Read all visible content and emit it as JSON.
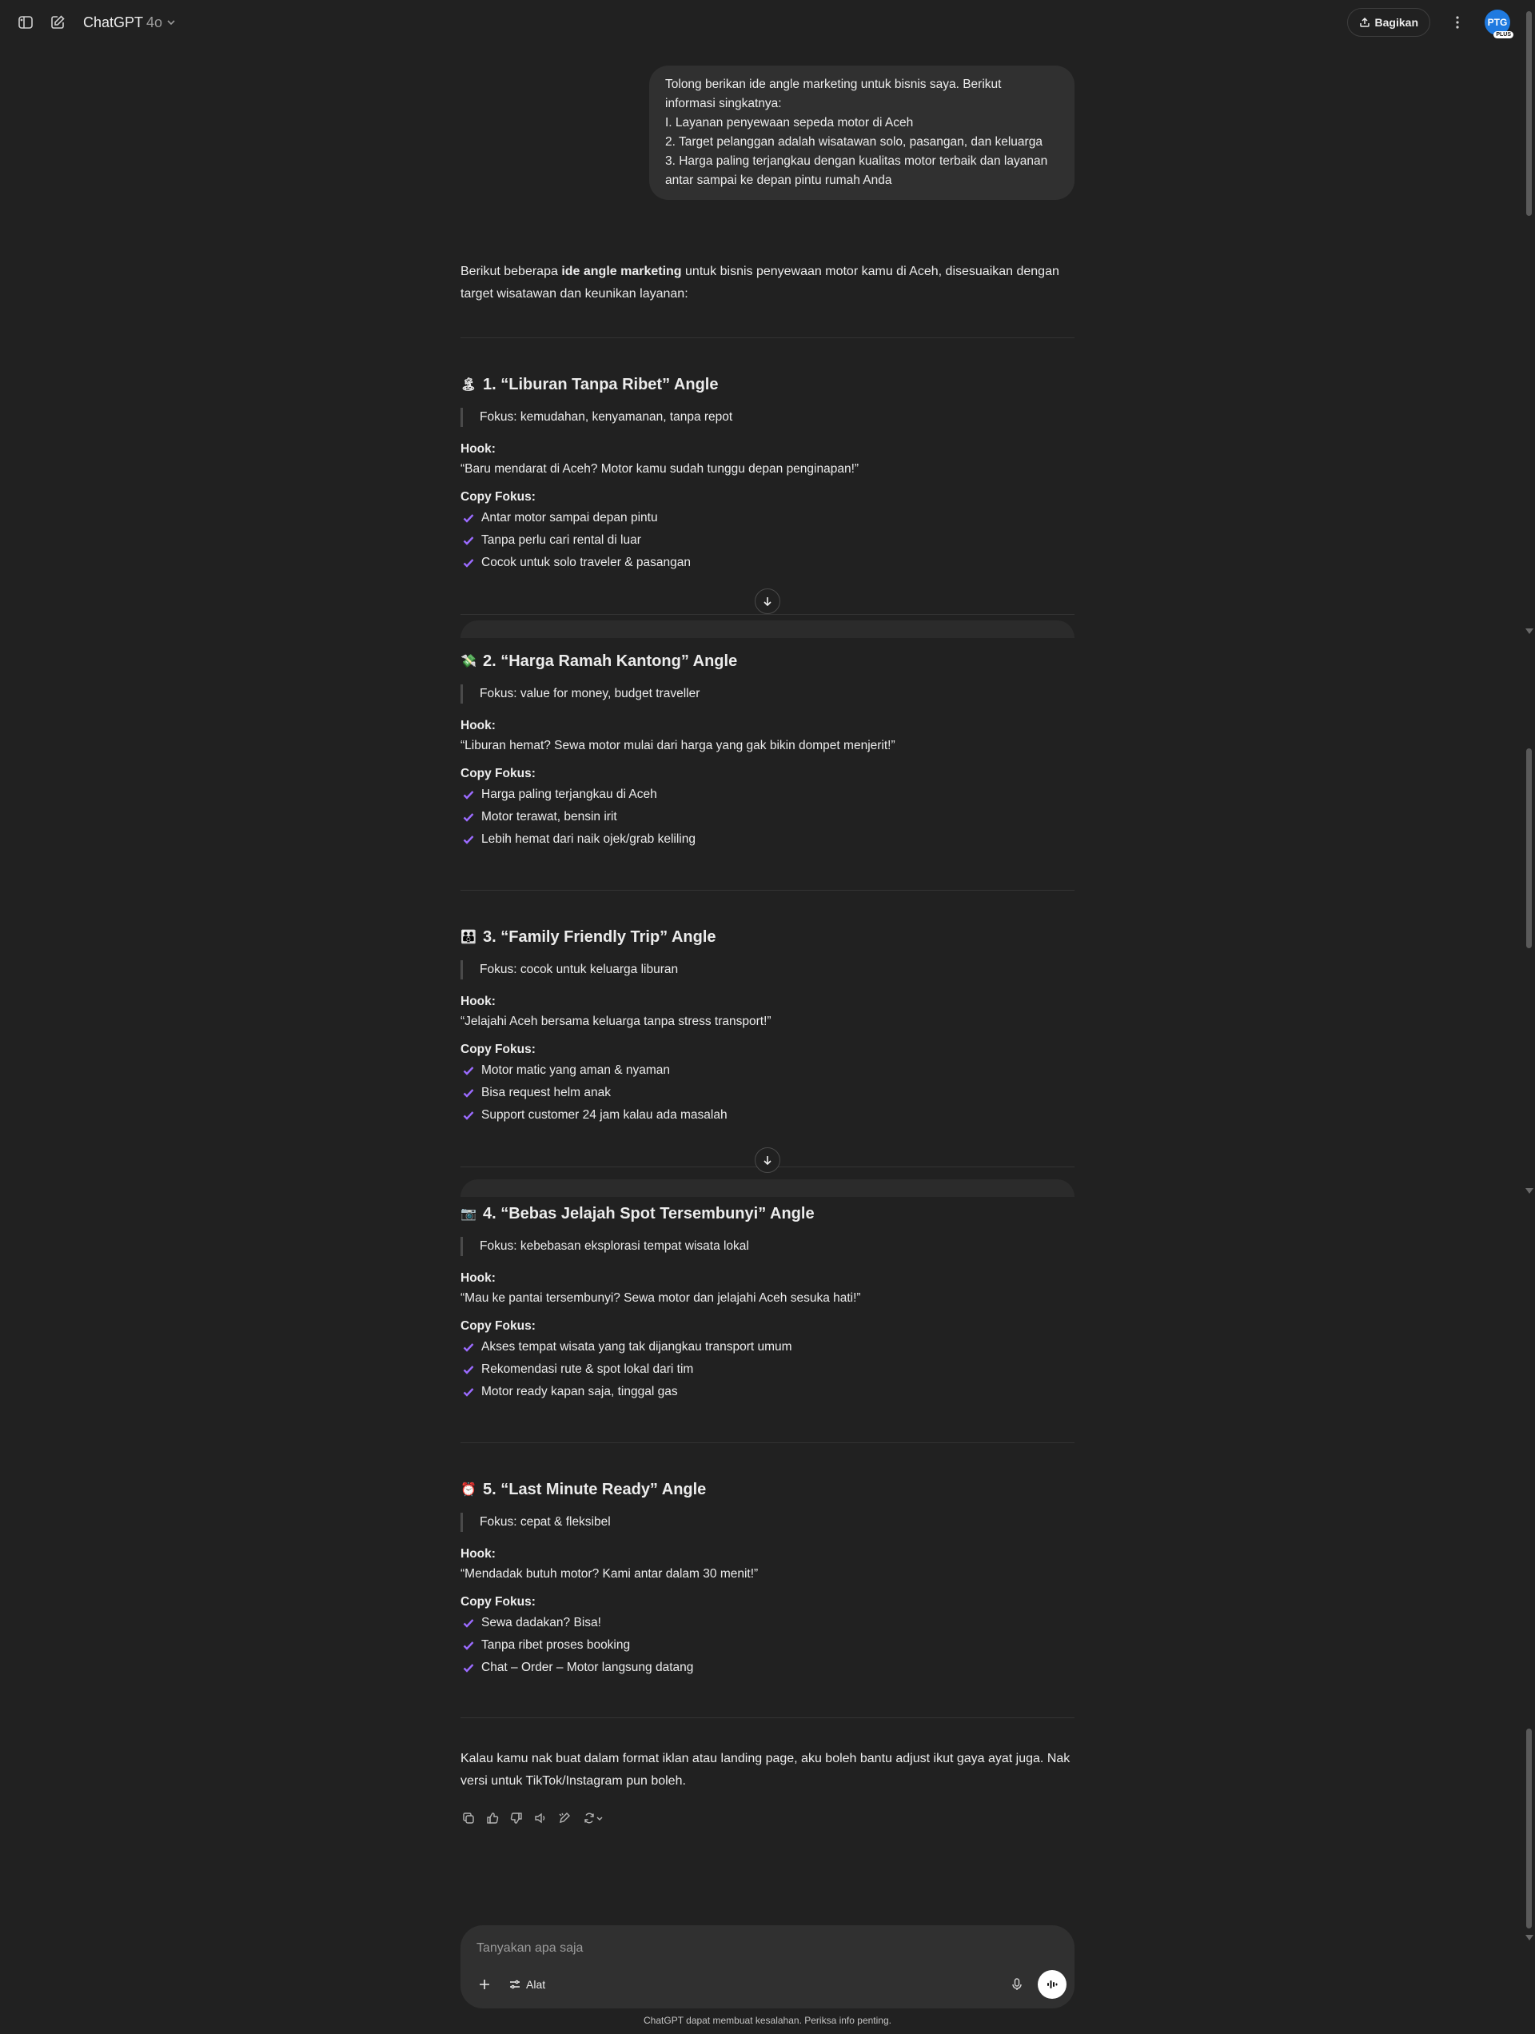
{
  "header": {
    "model_name": "ChatGPT",
    "model_version": "4o",
    "share_label": "Bagikan",
    "avatar_initials": "PTG",
    "plan_badge": "PLUS"
  },
  "user_message": {
    "lines": [
      "Tolong berikan ide angle marketing untuk bisnis saya. Berikut",
      "informasi singkatnya:",
      "I. Layanan penyewaan sepeda motor di Aceh",
      "2. Target pelanggan adalah wisatawan solo, pasangan, dan keluarga",
      "3. Harga paling terjangkau dengan kualitas motor terbaik dan layanan",
      "antar sampai ke depan pintu rumah Anda"
    ]
  },
  "intro": {
    "before": "Berikut beberapa ",
    "bold": "ide angle marketing",
    "after": " untuk bisnis penyewaan motor kamu di Aceh, disesuaikan dengan target wisatawan dan keunikan layanan:"
  },
  "labels": {
    "hook": "Hook:",
    "copy": "Copy Fokus:"
  },
  "sections": [
    {
      "emoji": "🏝",
      "title": "1. “Liburan Tanpa Ribet” Angle",
      "focus": "Fokus: kemudahan, kenyamanan, tanpa repot",
      "hook": "“Baru mendarat di Aceh? Motor kamu sudah tunggu depan penginapan!”",
      "points": [
        "Antar motor sampai depan pintu",
        "Tanpa perlu cari rental di luar",
        "Cocok untuk solo traveler & pasangan"
      ]
    },
    {
      "emoji": "💸",
      "title": "2. “Harga Ramah Kantong” Angle",
      "focus": "Fokus: value for money, budget traveller",
      "hook": "“Liburan hemat? Sewa motor mulai dari harga yang gak bikin dompet menjerit!”",
      "points": [
        "Harga paling terjangkau di Aceh",
        "Motor terawat, bensin irit",
        "Lebih hemat dari naik ojek/grab keliling"
      ]
    },
    {
      "emoji": "👪",
      "title": "3. “Family Friendly Trip” Angle",
      "focus": "Fokus: cocok untuk keluarga liburan",
      "hook": "“Jelajahi Aceh bersama keluarga tanpa stress transport!”",
      "points": [
        "Motor matic yang aman & nyaman",
        "Bisa request helm anak",
        "Support customer 24 jam kalau ada masalah"
      ]
    },
    {
      "emoji": "📷",
      "title": "4. “Bebas Jelajah Spot Tersembunyi” Angle",
      "focus": "Fokus: kebebasan eksplorasi tempat wisata lokal",
      "hook": "“Mau ke pantai tersembunyi? Sewa motor dan jelajahi Aceh sesuka hati!”",
      "points": [
        "Akses tempat wisata yang tak dijangkau transport umum",
        "Rekomendasi rute & spot lokal dari tim",
        "Motor ready kapan saja, tinggal gas"
      ]
    },
    {
      "emoji": "⏰",
      "title": "5. “Last Minute Ready” Angle",
      "focus": "Fokus: cepat & fleksibel",
      "hook": "“Mendadak butuh motor? Kami antar dalam 30 menit!”",
      "points": [
        "Sewa dadakan? Bisa!",
        "Tanpa ribet proses booking",
        "Chat – Order – Motor langsung datang"
      ]
    }
  ],
  "outro": "Kalau kamu nak buat dalam format iklan atau landing page, aku boleh bantu adjust ikut gaya ayat juga. Nak versi untuk TikTok/Instagram pun boleh.",
  "composer": {
    "placeholder": "Tanyakan apa saja",
    "tools_label": "Alat"
  },
  "footer_note": "ChatGPT dapat membuat kesalahan. Periksa info penting.",
  "colors": {
    "background": "#212121",
    "bubble": "#303030",
    "check": "#9b6bff",
    "avatar": "#1f7ae0"
  }
}
